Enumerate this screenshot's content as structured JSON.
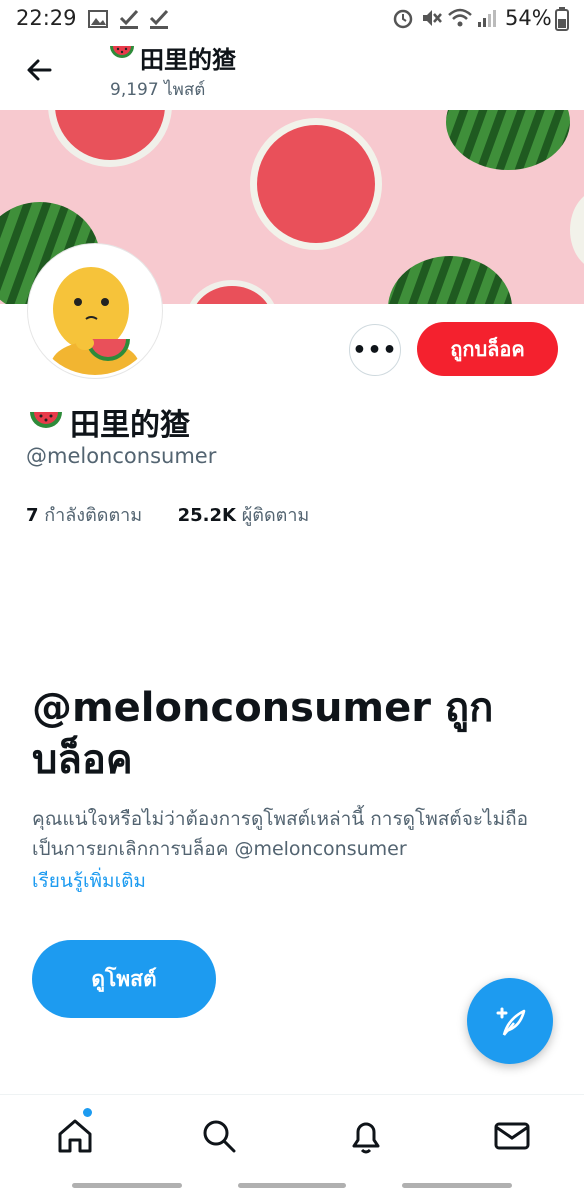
{
  "status_bar": {
    "time": "22:29",
    "battery": "54%"
  },
  "header": {
    "emoji": "🍉",
    "title": "田里的猹",
    "posts": "9,197 ไพสต์"
  },
  "profile": {
    "emoji": "🍉",
    "name": "田里的猹",
    "handle": "@melonconsumer",
    "following_count": "7",
    "following_label": "กำลังติดตาม",
    "followers_count": "25.2K",
    "followers_label": "ผู้ติดตาม",
    "more_label": "•••",
    "blocked_button": "ถูกบล็อค"
  },
  "blocked": {
    "title": "@melonconsumer ถูกบล็อค",
    "description": "คุณแน่ใจหรือไม่ว่าต้องการดูโพสต์เหล่านี้ การดูโพสต์จะไม่ถือเป็นการยกเลิกการบล็อค @melonconsumer",
    "learn_more": "เรียนรู้เพิ่มเติม",
    "view_posts": "ดูโพสต์"
  },
  "nav": {
    "items": [
      {
        "icon": "home-icon"
      },
      {
        "icon": "search-icon"
      },
      {
        "icon": "bell-icon"
      },
      {
        "icon": "mail-icon"
      }
    ]
  },
  "colors": {
    "accent": "#1d9bf0",
    "blocked": "#f4212e",
    "banner": "#f7c9cf"
  }
}
